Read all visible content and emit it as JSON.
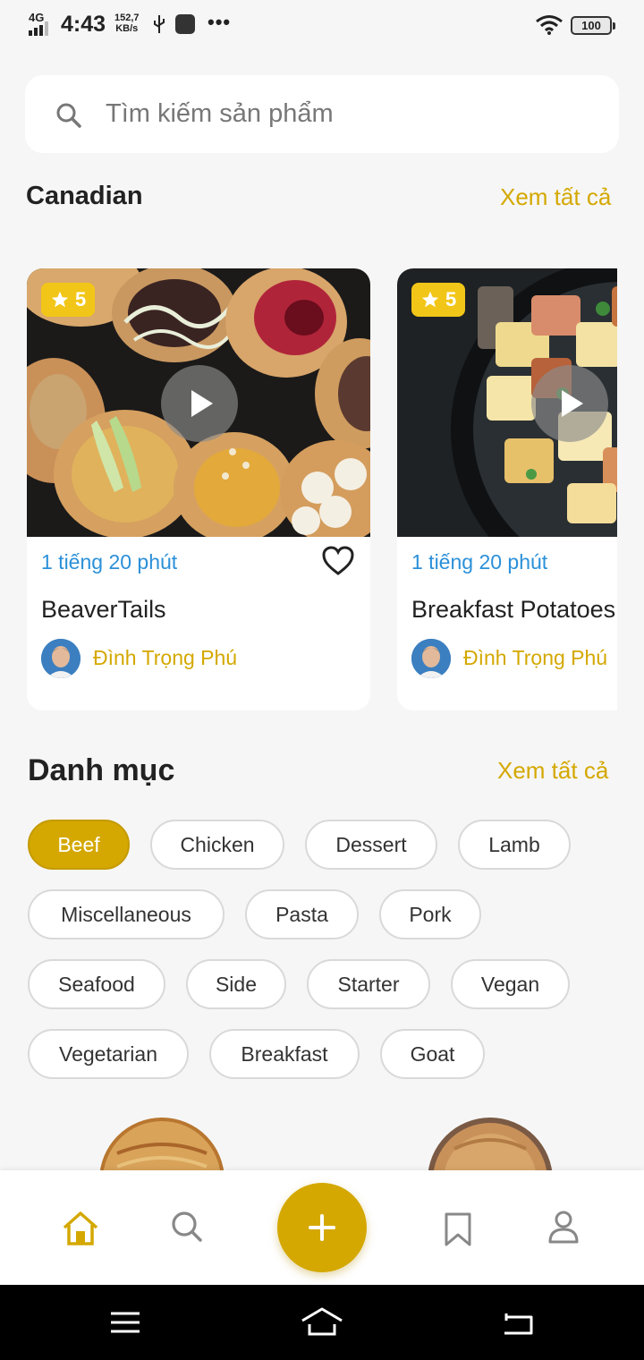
{
  "status_bar": {
    "network": "4G",
    "time": "4:43",
    "speed_value": "152,7",
    "speed_unit": "KB/s",
    "more": "•••",
    "battery": "100"
  },
  "search": {
    "placeholder": "Tìm kiếm sản phẩm",
    "icon": "search-icon"
  },
  "featured": {
    "title": "Canadian",
    "see_all": "Xem tất cả",
    "cards": [
      {
        "rating": "5",
        "duration": "1 tiếng 20 phút",
        "name": "BeaverTails",
        "author": "Đình Trọng Phú"
      },
      {
        "rating": "5",
        "duration": "1 tiếng 20 phút",
        "name": "Breakfast Potatoes",
        "author": "Đình Trọng Phú"
      }
    ]
  },
  "categories": {
    "title": "Danh mục",
    "see_all": "Xem tất cả",
    "selected": "Beef",
    "items": [
      "Beef",
      "Chicken",
      "Dessert",
      "Lamb",
      "Miscellaneous",
      "Pasta",
      "Pork",
      "Seafood",
      "Side",
      "Starter",
      "Vegan",
      "Vegetarian",
      "Breakfast",
      "Goat"
    ]
  },
  "bottom_nav": {
    "items": [
      "home-icon",
      "search-icon",
      "add-icon",
      "bookmark-icon",
      "profile-icon"
    ],
    "active": "home-icon"
  },
  "colors": {
    "accent": "#d4a800",
    "rating_badge": "#f2c618",
    "duration": "#2b90d9",
    "background": "#f6f6f6"
  }
}
